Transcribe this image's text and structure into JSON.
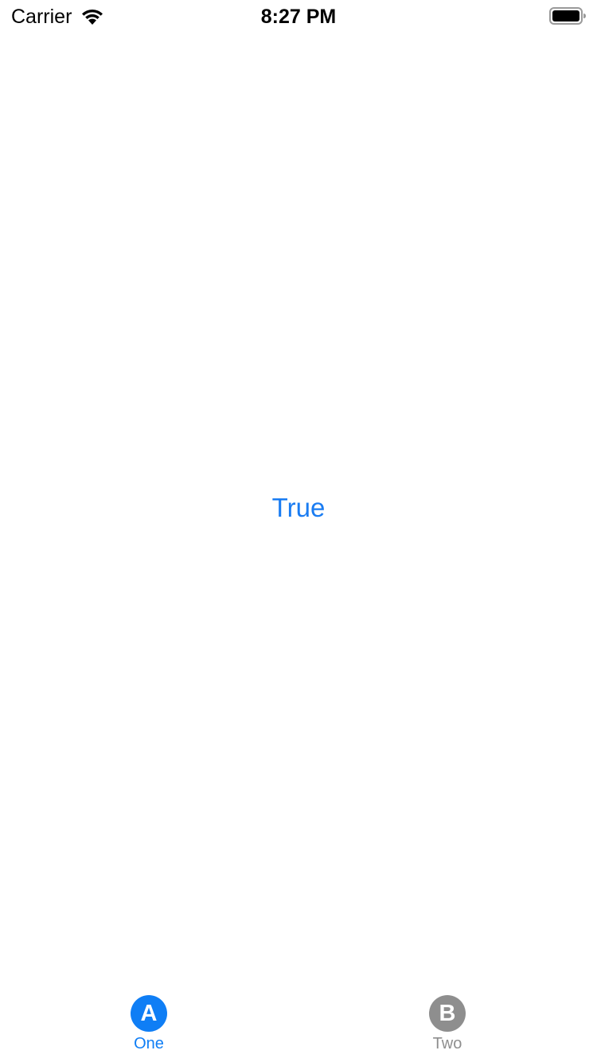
{
  "status_bar": {
    "carrier": "Carrier",
    "time": "8:27 PM",
    "icons": [
      "wifi-icon",
      "battery-icon"
    ]
  },
  "main": {
    "label": "True",
    "label_color": "#1a7cf2"
  },
  "tab_bar": {
    "tabs": [
      {
        "icon_letter": "A",
        "label": "One",
        "selected": true,
        "color": "#0f7ef5"
      },
      {
        "icon_letter": "B",
        "label": "Two",
        "selected": false,
        "color": "#8e8e8e"
      }
    ]
  }
}
